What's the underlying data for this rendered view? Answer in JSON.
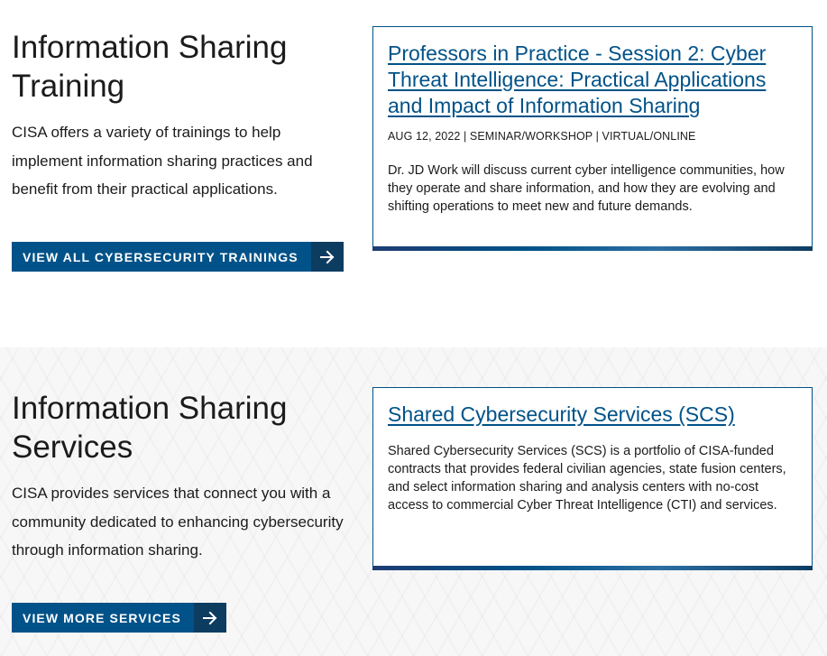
{
  "training": {
    "heading": "Information Sharing Training",
    "description": "CISA offers a variety of trainings to help implement information sharing practices and benefit from their practical applications.",
    "button_label": "VIEW ALL CYBERSECURITY TRAININGS",
    "card": {
      "title": "Professors in Practice - Session 2: Cyber Threat Intelligence: Practical Applications and Impact of Information Sharing",
      "meta": "AUG 12, 2022 | SEMINAR/WORKSHOP | VIRTUAL/ONLINE",
      "body": "Dr. JD Work will discuss current cyber intelligence communities, how they operate and share information, and how they are evolving and shifting operations to meet new and future demands."
    }
  },
  "services": {
    "heading": "Information Sharing Services",
    "description": "CISA provides services that connect you with a community dedicated to enhancing cybersecurity through information sharing.",
    "button_label": "VIEW MORE SERVICES",
    "card": {
      "title": "Shared Cybersecurity Services (SCS)",
      "body": "Shared Cybersecurity Services (SCS) is a portfolio of CISA-funded contracts that provides federal civilian agencies, state fusion centers, and select information sharing and analysis centers with no-cost access to commercial Cyber Threat Intelligence (CTI) and services."
    }
  },
  "colors": {
    "primary": "#005288",
    "primary_dark": "#0d3c61",
    "text": "#1b1b1b"
  },
  "icons": {
    "button_arrow": "arrow-right-icon"
  }
}
